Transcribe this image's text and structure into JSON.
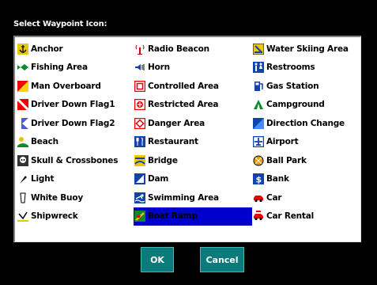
{
  "dialog": {
    "title": "Select Waypoint Icon:"
  },
  "icons": [
    {
      "label": "Anchor",
      "icon": "anchor-icon"
    },
    {
      "label": "Radio Beacon",
      "icon": "radio-beacon-icon"
    },
    {
      "label": "Water Skiing Area",
      "icon": "water-skiing-icon"
    },
    {
      "label": "Fishing Area",
      "icon": "fish-icon"
    },
    {
      "label": "Horn",
      "icon": "horn-icon"
    },
    {
      "label": "Restrooms",
      "icon": "restrooms-icon"
    },
    {
      "label": "Man Overboard",
      "icon": "man-overboard-icon"
    },
    {
      "label": "Controlled Area",
      "icon": "controlled-area-icon"
    },
    {
      "label": "Gas Station",
      "icon": "gas-station-icon"
    },
    {
      "label": "Driver Down Flag1",
      "icon": "diver-flag1-icon"
    },
    {
      "label": "Restricted Area",
      "icon": "restricted-area-icon"
    },
    {
      "label": "Campground",
      "icon": "campground-icon"
    },
    {
      "label": "Driver Down Flag2",
      "icon": "diver-flag2-icon"
    },
    {
      "label": "Danger Area",
      "icon": "danger-area-icon"
    },
    {
      "label": "Direction Change",
      "icon": "direction-change-icon"
    },
    {
      "label": "Beach",
      "icon": "beach-icon"
    },
    {
      "label": "Restaurant",
      "icon": "restaurant-icon"
    },
    {
      "label": "Airport",
      "icon": "airport-icon"
    },
    {
      "label": "Skull & Crossbones",
      "icon": "skull-icon"
    },
    {
      "label": "Bridge",
      "icon": "bridge-icon"
    },
    {
      "label": "Ball Park",
      "icon": "ball-park-icon"
    },
    {
      "label": "Light",
      "icon": "light-icon"
    },
    {
      "label": "Dam",
      "icon": "dam-icon"
    },
    {
      "label": "Bank",
      "icon": "bank-icon"
    },
    {
      "label": "White Buoy",
      "icon": "buoy-icon"
    },
    {
      "label": "Swimming Area",
      "icon": "swimming-icon"
    },
    {
      "label": "Car",
      "icon": "car-icon"
    },
    {
      "label": "Shipwreck",
      "icon": "shipwreck-icon"
    },
    {
      "label": "Boat Ramp",
      "icon": "boat-ramp-icon",
      "selected": true
    },
    {
      "label": "Car Rental",
      "icon": "car-rental-icon"
    }
  ],
  "buttons": {
    "ok": "OK",
    "cancel": "Cancel"
  },
  "scrollbar": {
    "left_arrow": "◂",
    "right_arrow": "▸"
  }
}
